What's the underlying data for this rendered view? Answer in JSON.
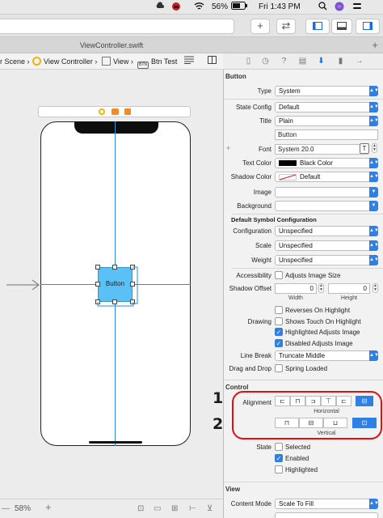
{
  "menubar": {
    "battery": "56%",
    "clock": "Fri 1:43 PM"
  },
  "tabbar": {
    "title": "ViewController.swift",
    "plus": "+"
  },
  "jumpbar": {
    "crumbs": [
      "r Scene",
      "View Controller",
      "View",
      "Btn Test"
    ],
    "btn_badge": "BTN"
  },
  "canvas": {
    "button_title": "Button",
    "zoom": "58%"
  },
  "inspector": {
    "button_section": "Button",
    "type_label": "Type",
    "type_value": "System",
    "state_config_label": "State Config",
    "state_config_value": "Default",
    "title_label": "Title",
    "title_style": "Plain",
    "title_text": "Button",
    "font_label": "Font",
    "font_value": "System 20.0",
    "text_color_label": "Text Color",
    "text_color_value": "Black Color",
    "shadow_color_label": "Shadow Color",
    "shadow_color_value": "Default",
    "image_label": "Image",
    "background_label": "Background",
    "symbol_section": "Default Symbol Configuration",
    "configuration_label": "Configuration",
    "configuration_value": "Unspecified",
    "scale_label": "Scale",
    "scale_value": "Unspecified",
    "weight_label": "Weight",
    "weight_value": "Unspecified",
    "accessibility_label": "Accessibility",
    "adjusts_image_size": "Adjusts Image Size",
    "shadow_offset_label": "Shadow Offset",
    "shadow_w": "0",
    "shadow_h": "0",
    "width_caption": "Width",
    "height_caption": "Height",
    "reverses_highlight": "Reverses On Highlight",
    "drawing_label": "Drawing",
    "shows_touch": "Shows Touch On Highlight",
    "highlighted_adjusts": "Highlighted Adjusts Image",
    "disabled_adjusts": "Disabled Adjusts Image",
    "line_break_label": "Line Break",
    "line_break_value": "Truncate Middle",
    "drag_drop_label": "Drag and Drop",
    "spring_loaded": "Spring Loaded",
    "control_section": "Control",
    "alignment_label": "Alignment",
    "horizontal_caption": "Horizontal",
    "vertical_caption": "Vertical",
    "state_label": "State",
    "state_selected": "Selected",
    "state_enabled": "Enabled",
    "state_highlighted": "Highlighted",
    "view_section": "View",
    "content_mode_label": "Content Mode",
    "content_mode_value": "Scale To Fill"
  },
  "annotations": {
    "one": "1",
    "two": "2"
  },
  "colors": {
    "accent": "#2f7fe6",
    "button_fill": "#5ac0f5",
    "annotation_ring": "#e01010"
  }
}
